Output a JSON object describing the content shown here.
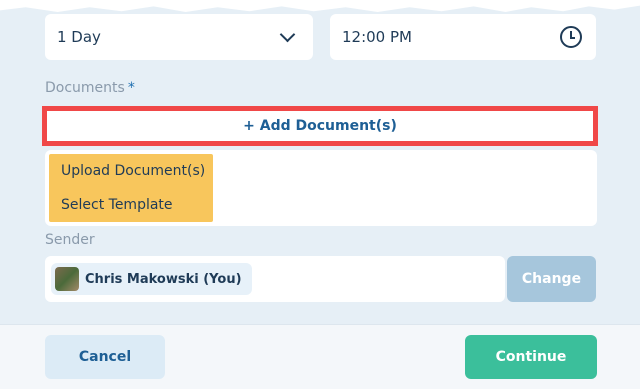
{
  "form": {
    "duration_value": "1 Day",
    "time_value": "12:00 PM",
    "documents_label": "Documents",
    "required_mark": "*",
    "add_document_label": "+ Add Document(s)",
    "document_menu": [
      {
        "label": "Upload Document(s)"
      },
      {
        "label": "Select Template"
      }
    ],
    "sender_label": "Sender",
    "sender_name": "Chris Makowski (You)",
    "change_label": "Change"
  },
  "footer": {
    "cancel_label": "Cancel",
    "continue_label": "Continue"
  },
  "colors": {
    "highlight_border": "#f04848",
    "menu_highlight": "#f8c65c",
    "continue": "#3bbf9b",
    "change_disabled": "#a6c6dc"
  }
}
